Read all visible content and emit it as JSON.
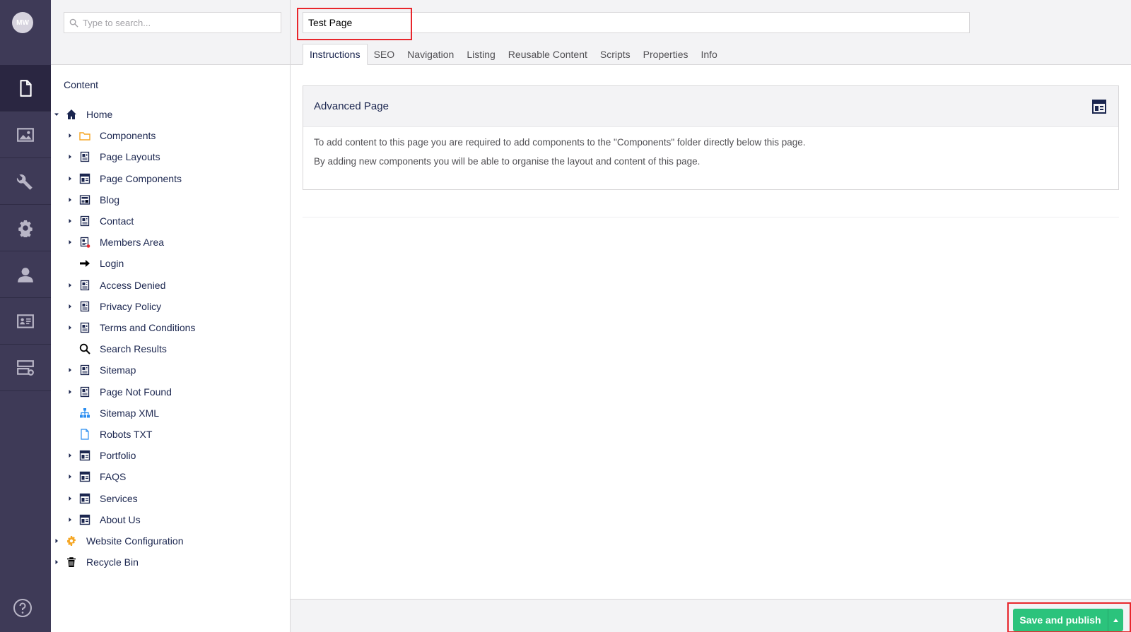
{
  "user": {
    "initials": "MW"
  },
  "sections": [
    {
      "name": "content",
      "icon": "document-icon"
    },
    {
      "name": "media",
      "icon": "image-icon"
    },
    {
      "name": "settings",
      "icon": "wrench-icon"
    },
    {
      "name": "packages",
      "icon": "gear-icon"
    },
    {
      "name": "users",
      "icon": "user-icon"
    },
    {
      "name": "members",
      "icon": "id-card-icon"
    },
    {
      "name": "forms",
      "icon": "server-icon"
    }
  ],
  "tree": {
    "search_placeholder": "Type to search...",
    "title": "Content",
    "nodes": [
      {
        "label": "Home",
        "icon": "home-icon",
        "level": 0,
        "expanded": true
      },
      {
        "label": "Components",
        "icon": "folder-icon",
        "level": 1
      },
      {
        "label": "Page Layouts",
        "icon": "page-icon",
        "level": 1
      },
      {
        "label": "Page Components",
        "icon": "layout-icon",
        "level": 1
      },
      {
        "label": "Blog",
        "icon": "newspaper-icon",
        "level": 1
      },
      {
        "label": "Contact",
        "icon": "page-icon",
        "level": 1
      },
      {
        "label": "Members Area",
        "icon": "locked-page-icon",
        "level": 1
      },
      {
        "label": "Login",
        "icon": "arrow-right-icon",
        "level": 1,
        "leaf": true
      },
      {
        "label": "Access Denied",
        "icon": "page-icon",
        "level": 1
      },
      {
        "label": "Privacy Policy",
        "icon": "page-icon",
        "level": 1
      },
      {
        "label": "Terms and Conditions",
        "icon": "page-icon",
        "level": 1
      },
      {
        "label": "Search Results",
        "icon": "search-icon",
        "level": 1,
        "leaf": true
      },
      {
        "label": "Sitemap",
        "icon": "page-icon",
        "level": 1
      },
      {
        "label": "Page Not Found",
        "icon": "page-icon",
        "level": 1
      },
      {
        "label": "Sitemap XML",
        "icon": "sitemap-icon",
        "level": 1,
        "leaf": true
      },
      {
        "label": "Robots TXT",
        "icon": "file-icon",
        "level": 1,
        "leaf": true
      },
      {
        "label": "Portfolio",
        "icon": "layout-icon",
        "level": 1
      },
      {
        "label": "FAQS",
        "icon": "layout-icon",
        "level": 1
      },
      {
        "label": "Services",
        "icon": "layout-icon",
        "level": 1
      },
      {
        "label": "About Us",
        "icon": "layout-icon",
        "level": 1
      },
      {
        "label": "Website Configuration",
        "icon": "cog-orange-icon",
        "level": 0
      },
      {
        "label": "Recycle Bin",
        "icon": "trash-icon",
        "level": 0
      }
    ]
  },
  "editor": {
    "page_name": "Test Page",
    "tabs": [
      "Instructions",
      "SEO",
      "Navigation",
      "Listing",
      "Reusable Content",
      "Scripts",
      "Properties",
      "Info"
    ],
    "active_tab": "Instructions",
    "panel": {
      "title": "Advanced Page",
      "lines": [
        "To add content to this page you are required to add components to the \"Components\" folder directly below this page.",
        "By adding new components you will be able to organise the layout and content of this page."
      ]
    },
    "publish_label": "Save and publish"
  },
  "colors": {
    "nav_bg": "#3e3a57",
    "publish_green": "#2bc37c",
    "highlight_red": "#e8262c"
  }
}
